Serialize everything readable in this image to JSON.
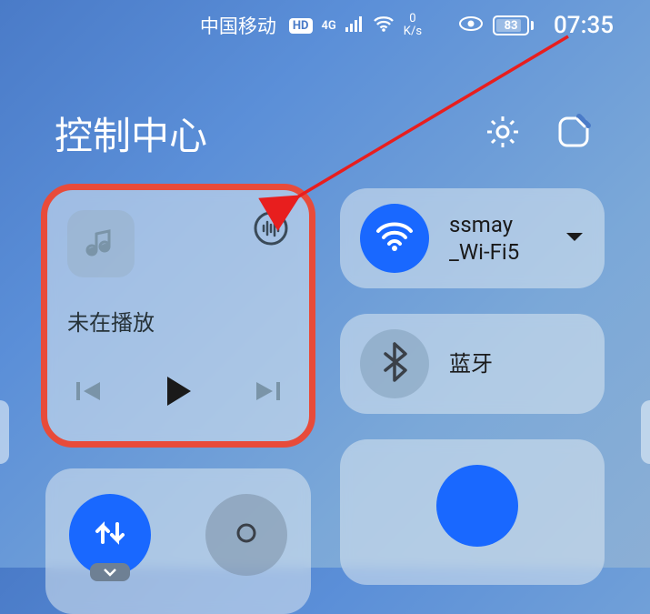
{
  "statusBar": {
    "carrier": "中国移动",
    "hd": "HD",
    "network": "4G",
    "speedNum": "0",
    "speedUnit": "K/s",
    "battery": "83",
    "time": "07:35"
  },
  "header": {
    "title": "控制中心"
  },
  "music": {
    "status": "未在播放"
  },
  "wifi": {
    "line1": "ssmay",
    "line2": "_Wi-Fi5"
  },
  "bluetooth": {
    "label": "蓝牙"
  }
}
